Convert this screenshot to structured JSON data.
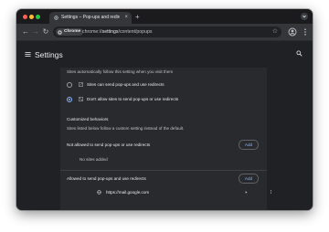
{
  "tab": {
    "title": "Settings – Pop-ups and redirects",
    "close_glyph": "×",
    "new_tab_glyph": "+"
  },
  "toolbar": {
    "back_glyph": "←",
    "forward_glyph": "→",
    "reload_glyph": "↻",
    "chip_label": "Chrome",
    "url_prefix": "chrome://",
    "url_host": "settings",
    "url_path": "/content/popups",
    "bookmark_glyph": "☆"
  },
  "header": {
    "title": "Settings"
  },
  "content": {
    "default_behavior_desc": "Sites automatically follow this setting when you visit them",
    "options": [
      {
        "label": "Sites can send pop-ups and use redirects",
        "selected": false
      },
      {
        "label": "Don't allow sites to send pop-ups or use redirects",
        "selected": true
      }
    ],
    "custom_title": "Customized behaviors",
    "custom_desc": "Sites listed below follow a custom setting instead of the default.",
    "blocked_title": "Not allowed to send pop-ups or use redirects",
    "blocked_add": "Add",
    "blocked_empty": "No sites added",
    "allowed_title": "Allowed to send pop-ups and use redirects",
    "allowed_add": "Add",
    "allowed_sites": [
      {
        "url": "https://mail.google.com"
      }
    ]
  },
  "colors": {
    "accent": "#8ab4f8",
    "background": "#202124",
    "card": "#292a2d",
    "text": "#e8eaed"
  }
}
